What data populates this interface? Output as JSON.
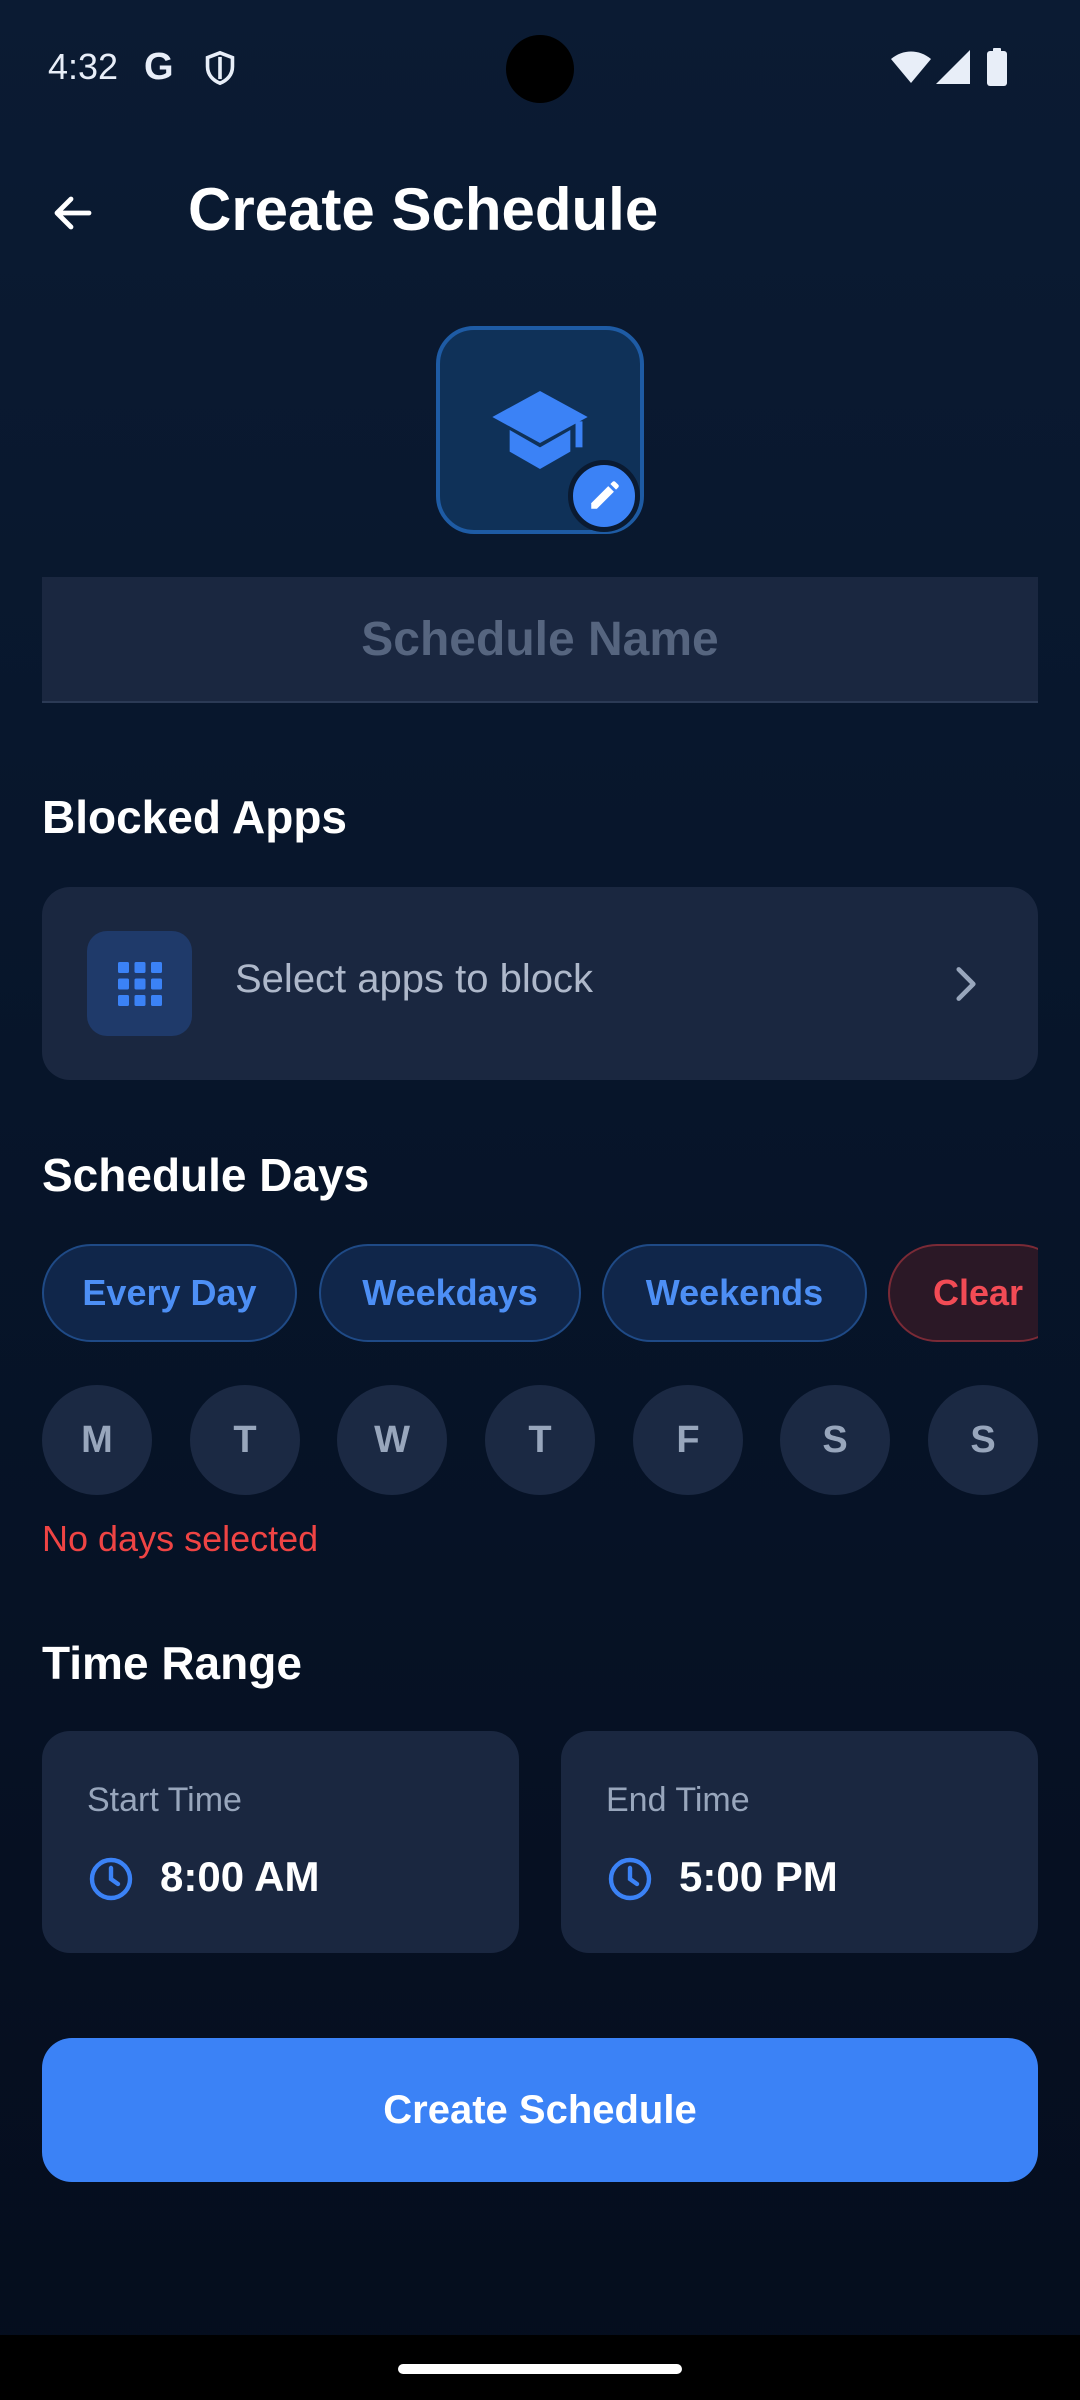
{
  "status_bar": {
    "time": "4:32",
    "google_glyph": "G",
    "icons": [
      "google-icon",
      "shield-icon",
      "wifi-icon",
      "signal-icon",
      "battery-icon"
    ]
  },
  "header": {
    "title": "Create Schedule",
    "back_icon": "arrow-left-icon"
  },
  "schedule_icon": {
    "icon": "graduation-cap-icon",
    "edit_icon": "pencil-icon"
  },
  "name_field": {
    "placeholder": "Schedule Name",
    "value": ""
  },
  "blocked_apps": {
    "heading": "Blocked Apps",
    "placeholder": "Select apps to block",
    "icon": "grid-icon",
    "chevron": "chevron-right-icon"
  },
  "schedule_days": {
    "heading": "Schedule Days",
    "presets": [
      "Every Day",
      "Weekdays",
      "Weekends",
      "Clear"
    ],
    "days": [
      "M",
      "T",
      "W",
      "T",
      "F",
      "S",
      "S"
    ],
    "selected": [],
    "error": "No days selected"
  },
  "time_range": {
    "heading": "Time Range",
    "start_label": "Start Time",
    "start_value": "8:00 AM",
    "end_label": "End Time",
    "end_value": "5:00 PM",
    "icon": "clock-icon"
  },
  "submit": {
    "label": "Create Schedule"
  },
  "colors": {
    "accent": "#3b82f6",
    "error": "#ef4444",
    "surface": "#1a2740",
    "background": "#07152a"
  }
}
